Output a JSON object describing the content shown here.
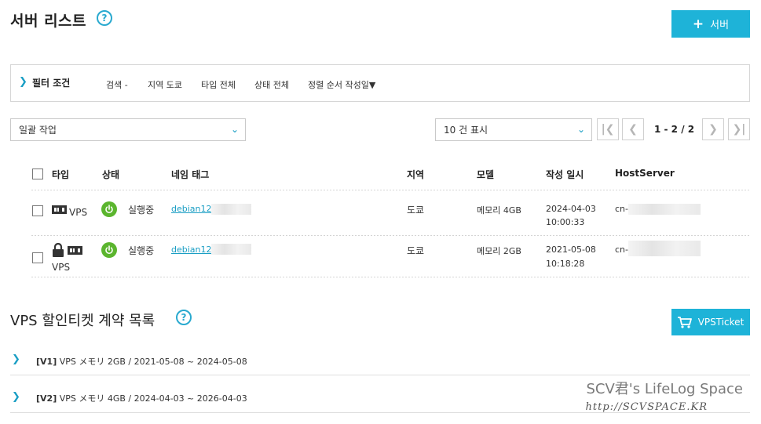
{
  "header": {
    "title": "서버 리스트",
    "help": "?",
    "add_button": "서버",
    "add_icon": "+"
  },
  "filter": {
    "chevron": "❯",
    "label": "필터 조건",
    "search": "검색 -",
    "region": "지역 도쿄",
    "type": "타입 전체",
    "status": "상태 전체",
    "sort": "정렬 순서 작성일▼"
  },
  "bulk_select": {
    "value": "일괄 작업",
    "caret": "⌄"
  },
  "page_size_select": {
    "value": "10 건 표시",
    "caret": "⌄"
  },
  "pagination": {
    "first": "|❮",
    "prev": "❮",
    "info": "1 - 2 / 2",
    "next": "❯",
    "last": "❯|"
  },
  "table": {
    "columns": [
      "타입",
      "상태",
      "네임 태그",
      "지역",
      "모델",
      "작성 일시",
      "HostServer"
    ],
    "rows": [
      {
        "type": "VPS",
        "locked": false,
        "status": "실행중",
        "name_tag": "debian12-",
        "region": "도쿄",
        "model": "메모리 4GB",
        "created_date": "2024-04-03",
        "created_time": "10:00:33",
        "host": "cn-"
      },
      {
        "type": "VPS",
        "locked": true,
        "status": "실행중",
        "name_tag": "debian12-",
        "region": "도쿄",
        "model": "메모리 2GB",
        "created_date": "2021-05-08",
        "created_time": "10:18:28",
        "host": "cn-"
      }
    ]
  },
  "contracts": {
    "title": "VPS 할인티켓 계약 목록",
    "help": "?",
    "button": "VPSTicket",
    "items": [
      {
        "tag": "[V1]",
        "text": "VPS メモリ 2GB / 2021-05-08 ~ 2024-05-08"
      },
      {
        "tag": "[V2]",
        "text": "VPS メモリ 4GB / 2024-04-03 ~ 2026-04-03"
      }
    ]
  },
  "watermark": {
    "line1": "SCV君's LifeLog Space",
    "line2": "http://SCVSPACE.KR"
  },
  "colors": {
    "accent": "#1eb3d8",
    "link": "#1a9ec4",
    "running": "#5bb52e"
  }
}
